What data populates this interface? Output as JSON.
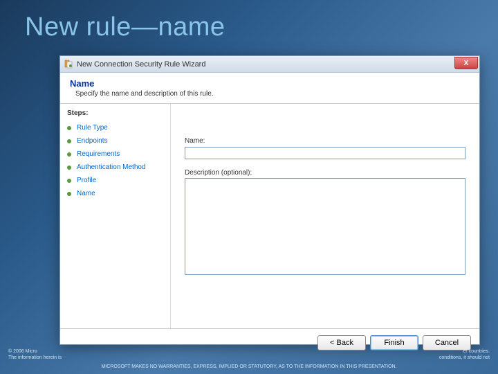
{
  "slide": {
    "title": "New rule—name"
  },
  "window": {
    "title": "New Connection Security Rule Wizard",
    "close_label": "X"
  },
  "header": {
    "title": "Name",
    "subtitle": "Specify the name and description of this rule."
  },
  "steps": {
    "label": "Steps:",
    "items": [
      {
        "label": "Rule Type"
      },
      {
        "label": "Endpoints"
      },
      {
        "label": "Requirements"
      },
      {
        "label": "Authentication Method"
      },
      {
        "label": "Profile"
      },
      {
        "label": "Name"
      }
    ]
  },
  "form": {
    "name_label": "Name:",
    "name_value": "",
    "desc_label": "Description (optional):",
    "desc_value": ""
  },
  "buttons": {
    "back": "< Back",
    "finish": "Finish",
    "cancel": "Cancel"
  },
  "footer": {
    "left1": "© 2006 Micro",
    "left2": "The information herein is",
    "right1": "er countries.",
    "right2": "conditions, it should not",
    "center": "MICROSOFT MAKES NO WARRANTIES, EXPRESS, IMPLIED OR STATUTORY, AS TO THE INFORMATION IN THIS PRESENTATION."
  }
}
